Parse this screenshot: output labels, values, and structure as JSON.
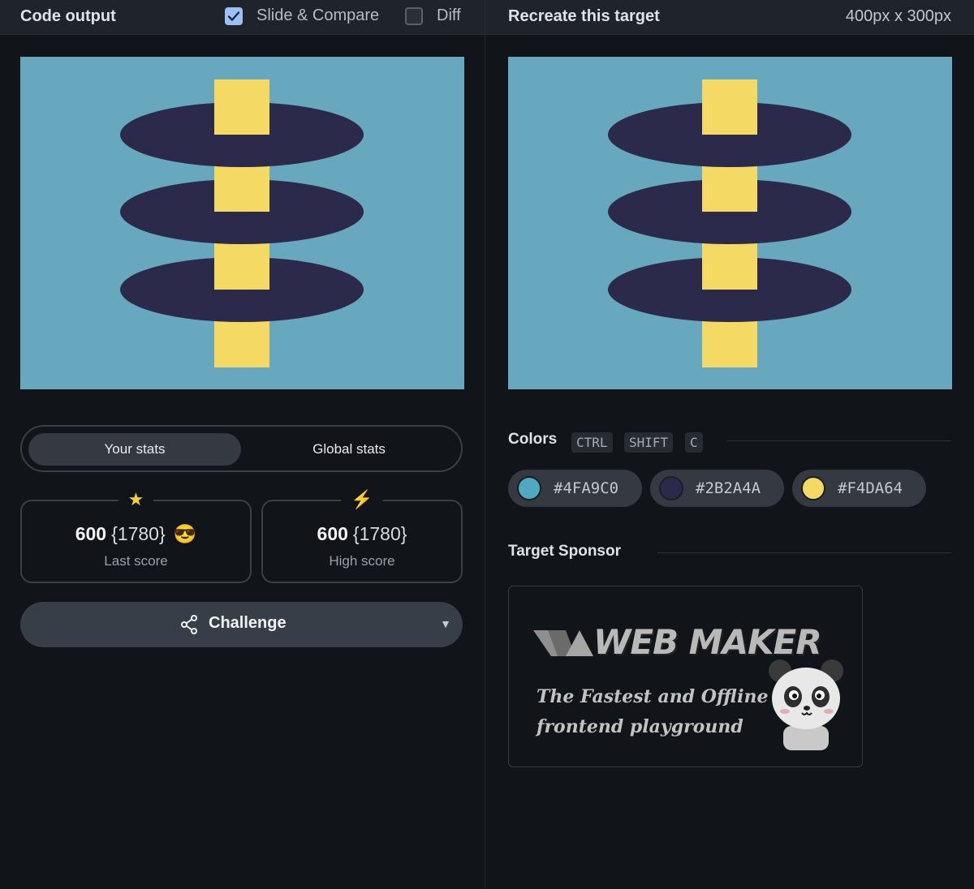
{
  "left_panel": {
    "title": "Code output",
    "options": [
      {
        "label": "Slide & Compare",
        "checked": true
      },
      {
        "label": "Diff",
        "checked": false
      }
    ]
  },
  "right_panel": {
    "title": "Recreate this target",
    "dimensions": "400px x 300px"
  },
  "stats": {
    "tabs": [
      "Your stats",
      "Global stats"
    ],
    "active_tab": "Your stats",
    "last": {
      "score": "600",
      "paren": "{1780}",
      "emoji": "😎",
      "label": "Last score",
      "badge": "★"
    },
    "high": {
      "score": "600",
      "paren": "{1780}",
      "label": "High score",
      "badge": "⚡"
    }
  },
  "challenge": {
    "label": "Challenge",
    "icon": "share-icon",
    "caret": "▼"
  },
  "colors_section": {
    "title": "Colors",
    "shortcut": [
      "CTRL",
      "SHIFT",
      "C"
    ],
    "swatches": [
      {
        "hex": "#4FA9C0"
      },
      {
        "hex": "#2B2A4A"
      },
      {
        "hex": "#F4DA64"
      }
    ]
  },
  "sponsor": {
    "title": "Target Sponsor",
    "brand": "WEB MAKER",
    "tagline_1": "The Fastest and Offline",
    "tagline_2": "frontend playground"
  },
  "theme": {
    "bg": "#111418",
    "canvas_bg": "#67a8bf",
    "ellipse": "#2b2a4a",
    "bar": "#f4da64"
  }
}
